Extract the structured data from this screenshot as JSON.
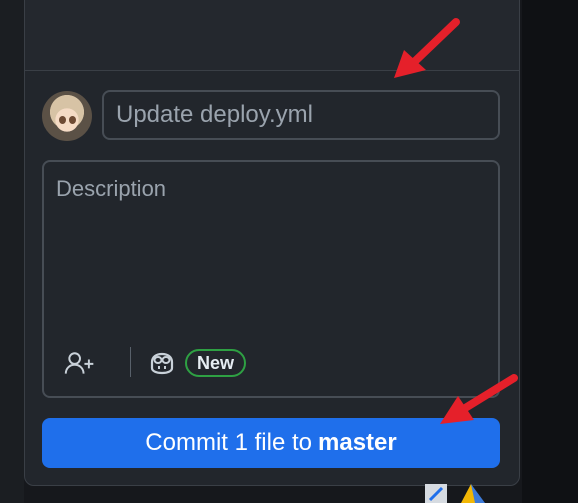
{
  "commit": {
    "summary_placeholder": "Update deploy.yml",
    "description_placeholder": "Description",
    "new_badge": "New",
    "button_prefix": "Commit 1 file to",
    "branch": "master"
  },
  "icons": [
    "add-coauthor-icon",
    "copilot-icon",
    "avatar"
  ],
  "colors": {
    "panel_bg": "#22262c",
    "button_bg": "#1f6feb",
    "badge_border": "#2ea043",
    "annotation_arrow": "#e5202a"
  }
}
